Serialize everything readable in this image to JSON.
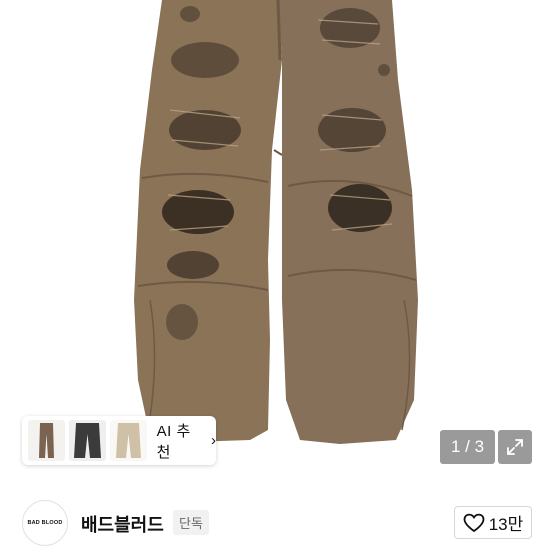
{
  "product_image": {
    "description_icon": "product-photo",
    "colors": {
      "fabric": "#8b7358",
      "fabric_dark": "#6e5a44",
      "hole": "#3a2e24",
      "background": "#ffffff"
    }
  },
  "ai_recommend": {
    "label": "AI 추천",
    "chevron": "›",
    "thumbnail_colors": [
      "#7a6350",
      "#3b3b3b",
      "#cfc0a8"
    ]
  },
  "gallery": {
    "counter": "1 / 3",
    "expand_icon": "expand-icon"
  },
  "shop": {
    "logo_text": "BAD BLOOD",
    "name": "배드블러드",
    "badge": "단독"
  },
  "like": {
    "icon": "heart-outline-icon",
    "count": "13만"
  }
}
